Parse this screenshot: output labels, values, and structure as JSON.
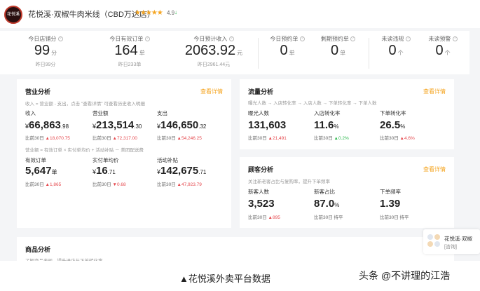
{
  "header": {
    "logo_text": "花悦溪",
    "store_name": "花悦溪·双椒牛肉米线（CBD万达店）",
    "stars": "★★★★★",
    "rating": "4.9"
  },
  "kpis": [
    {
      "label": "今日店铺分",
      "value": "99",
      "unit": "分",
      "sub": "昨日99分"
    },
    {
      "label": "今日有效订单",
      "value": "164",
      "unit": "单",
      "sub": "昨日233单"
    },
    {
      "label": "今日预计收入",
      "value": "2063.92",
      "unit": "元",
      "sub": "昨日2961.44元"
    },
    {
      "label": "今日预约单",
      "value": "0",
      "unit": "单",
      "sub": ""
    },
    {
      "label": "剩期预约单",
      "value": "0",
      "unit": "单",
      "sub": ""
    },
    {
      "label": "未读违规",
      "value": "0",
      "unit": "个",
      "sub": ""
    },
    {
      "label": "未读预警",
      "value": "0",
      "unit": "个",
      "sub": ""
    }
  ],
  "business": {
    "title": "营业分析",
    "link": "查看详情",
    "note1": "收入 = 营业额 - 支出，点击 \"查看详情\" 可查看历史收入明细",
    "note2": "营业额 = 有效订单 × 实付单均价 + 活动补贴 － 美团配送费",
    "metrics": [
      {
        "label": "收入",
        "yen": "¥",
        "int": "66,863",
        "dec": ".98",
        "cmp": "比前30日",
        "delta": "▲18,070.75"
      },
      {
        "label": "营业额",
        "yen": "¥",
        "int": "213,514",
        "dec": ".30",
        "cmp": "比前30日",
        "delta": "▲72,317.00"
      },
      {
        "label": "支出",
        "yen": "¥",
        "int": "146,650",
        "dec": ".32",
        "cmp": "比前30日",
        "delta": "▲54,246.25"
      },
      {
        "label": "有效订单",
        "yen": "",
        "int": "5,647",
        "dec": "单",
        "cmp": "比前30日",
        "delta": "▲1,865"
      },
      {
        "label": "实付单均价",
        "yen": "¥",
        "int": "16",
        "dec": ".71",
        "cmp": "比前30日",
        "delta": "▼0.68"
      },
      {
        "label": "活动补贴",
        "yen": "¥",
        "int": "142,675",
        "dec": ".71",
        "cmp": "比前30日",
        "delta": "▲47,923.79"
      }
    ]
  },
  "traffic": {
    "title": "流量分析",
    "link": "查看详情",
    "note": "曝光人数 → 入店转化率 → 入店人数 → 下单转化率 → 下单人数",
    "metrics": [
      {
        "label": "曝光人数",
        "value": "131,603",
        "unit": "",
        "cmp": "比前30日",
        "delta": "▲21,491"
      },
      {
        "label": "入店转化率",
        "value": "11.6",
        "unit": "%",
        "cmp": "比前30日",
        "delta": "▲0.2%"
      },
      {
        "label": "下单转化率",
        "value": "26.5",
        "unit": "%",
        "cmp": "比前30日",
        "delta": "▲4.6%"
      }
    ]
  },
  "customer": {
    "title": "顾客分析",
    "link": "查看详情",
    "note": "关注新老客占比与复购率，提升下单频率",
    "metrics": [
      {
        "label": "新客人数",
        "value": "3,523",
        "unit": "",
        "cmp": "比前30日",
        "delta": "▲895"
      },
      {
        "label": "新客占比",
        "value": "87.0",
        "unit": "%",
        "cmp": "比前30日 持平",
        "delta": ""
      },
      {
        "label": "下单频率",
        "value": "1.39",
        "unit": "",
        "cmp": "比前30日 持平",
        "delta": ""
      }
    ]
  },
  "product": {
    "title": "商品分析",
    "note": "了解商品表现，提升进店与下单转化率"
  },
  "float_card": {
    "line1": "花悦溪·双椒",
    "line2": "[咨询]"
  },
  "caption": "▲花悦溪外卖平台数据",
  "watermark": "头条 @不讲理的江浩",
  "colors": {
    "accent": "#f5a623",
    "up": "#e5484d",
    "flat": "#2db84d"
  }
}
